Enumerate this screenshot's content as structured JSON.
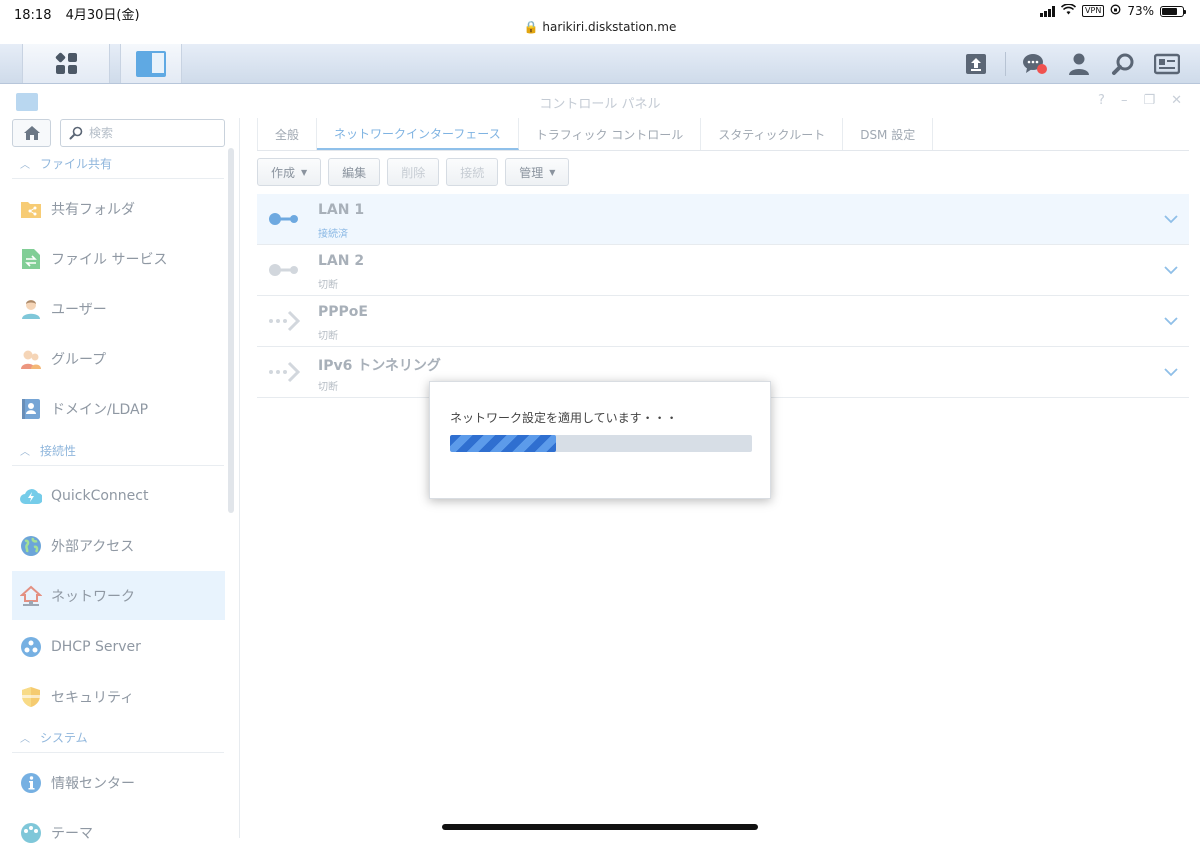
{
  "status_bar": {
    "time": "18:18",
    "date": "4月30日(金)",
    "url": "harikiri.diskstation.me",
    "vpn": "VPN",
    "battery": "73%"
  },
  "window": {
    "title": "コントロール パネル",
    "help": "?",
    "minimize": "–",
    "restore": "❐",
    "close": "✕"
  },
  "sidebar": {
    "search_placeholder": "検索",
    "sections": [
      {
        "label": "ファイル共有"
      },
      {
        "label": "接続性"
      },
      {
        "label": "システム"
      }
    ],
    "items": [
      {
        "label": "共有フォルダ",
        "icon": "shared-folder-icon"
      },
      {
        "label": "ファイル サービス",
        "icon": "file-services-icon"
      },
      {
        "label": "ユーザー",
        "icon": "user-icon"
      },
      {
        "label": "グループ",
        "icon": "group-icon"
      },
      {
        "label": "ドメイン/LDAP",
        "icon": "domain-ldap-icon"
      },
      {
        "label": "QuickConnect",
        "icon": "quickconnect-icon"
      },
      {
        "label": "外部アクセス",
        "icon": "external-access-icon"
      },
      {
        "label": "ネットワーク",
        "icon": "network-icon",
        "active": true
      },
      {
        "label": "DHCP Server",
        "icon": "dhcp-server-icon"
      },
      {
        "label": "セキュリティ",
        "icon": "security-icon"
      },
      {
        "label": "情報センター",
        "icon": "info-center-icon"
      },
      {
        "label": "テーマ",
        "icon": "theme-icon"
      }
    ]
  },
  "tabs": [
    {
      "label": "全般"
    },
    {
      "label": "ネットワークインターフェース",
      "active": true
    },
    {
      "label": "トラフィック コントロール"
    },
    {
      "label": "スタティックルート"
    },
    {
      "label": "DSM 設定"
    }
  ],
  "toolbar": {
    "create": "作成",
    "edit": "編集",
    "delete": "削除",
    "connect": "接続",
    "manage": "管理"
  },
  "interfaces": [
    {
      "name": "LAN 1",
      "status": "接続済",
      "icon": "lan-connected-icon"
    },
    {
      "name": "LAN 2",
      "status": "切断",
      "icon": "lan-disconnected-icon"
    },
    {
      "name": "PPPoE",
      "status": "切断",
      "icon": "pppoe-icon"
    },
    {
      "name": "IPv6 トンネリング",
      "status": "切断",
      "icon": "ipv6-tunnel-icon"
    }
  ],
  "modal": {
    "message": "ネットワーク設定を適用しています・・・",
    "progress": 0.35
  },
  "colors": {
    "accent": "#7fb3e2",
    "progress_fill": "#2f6fd0",
    "active_item_bg": "#e8f3fd"
  }
}
